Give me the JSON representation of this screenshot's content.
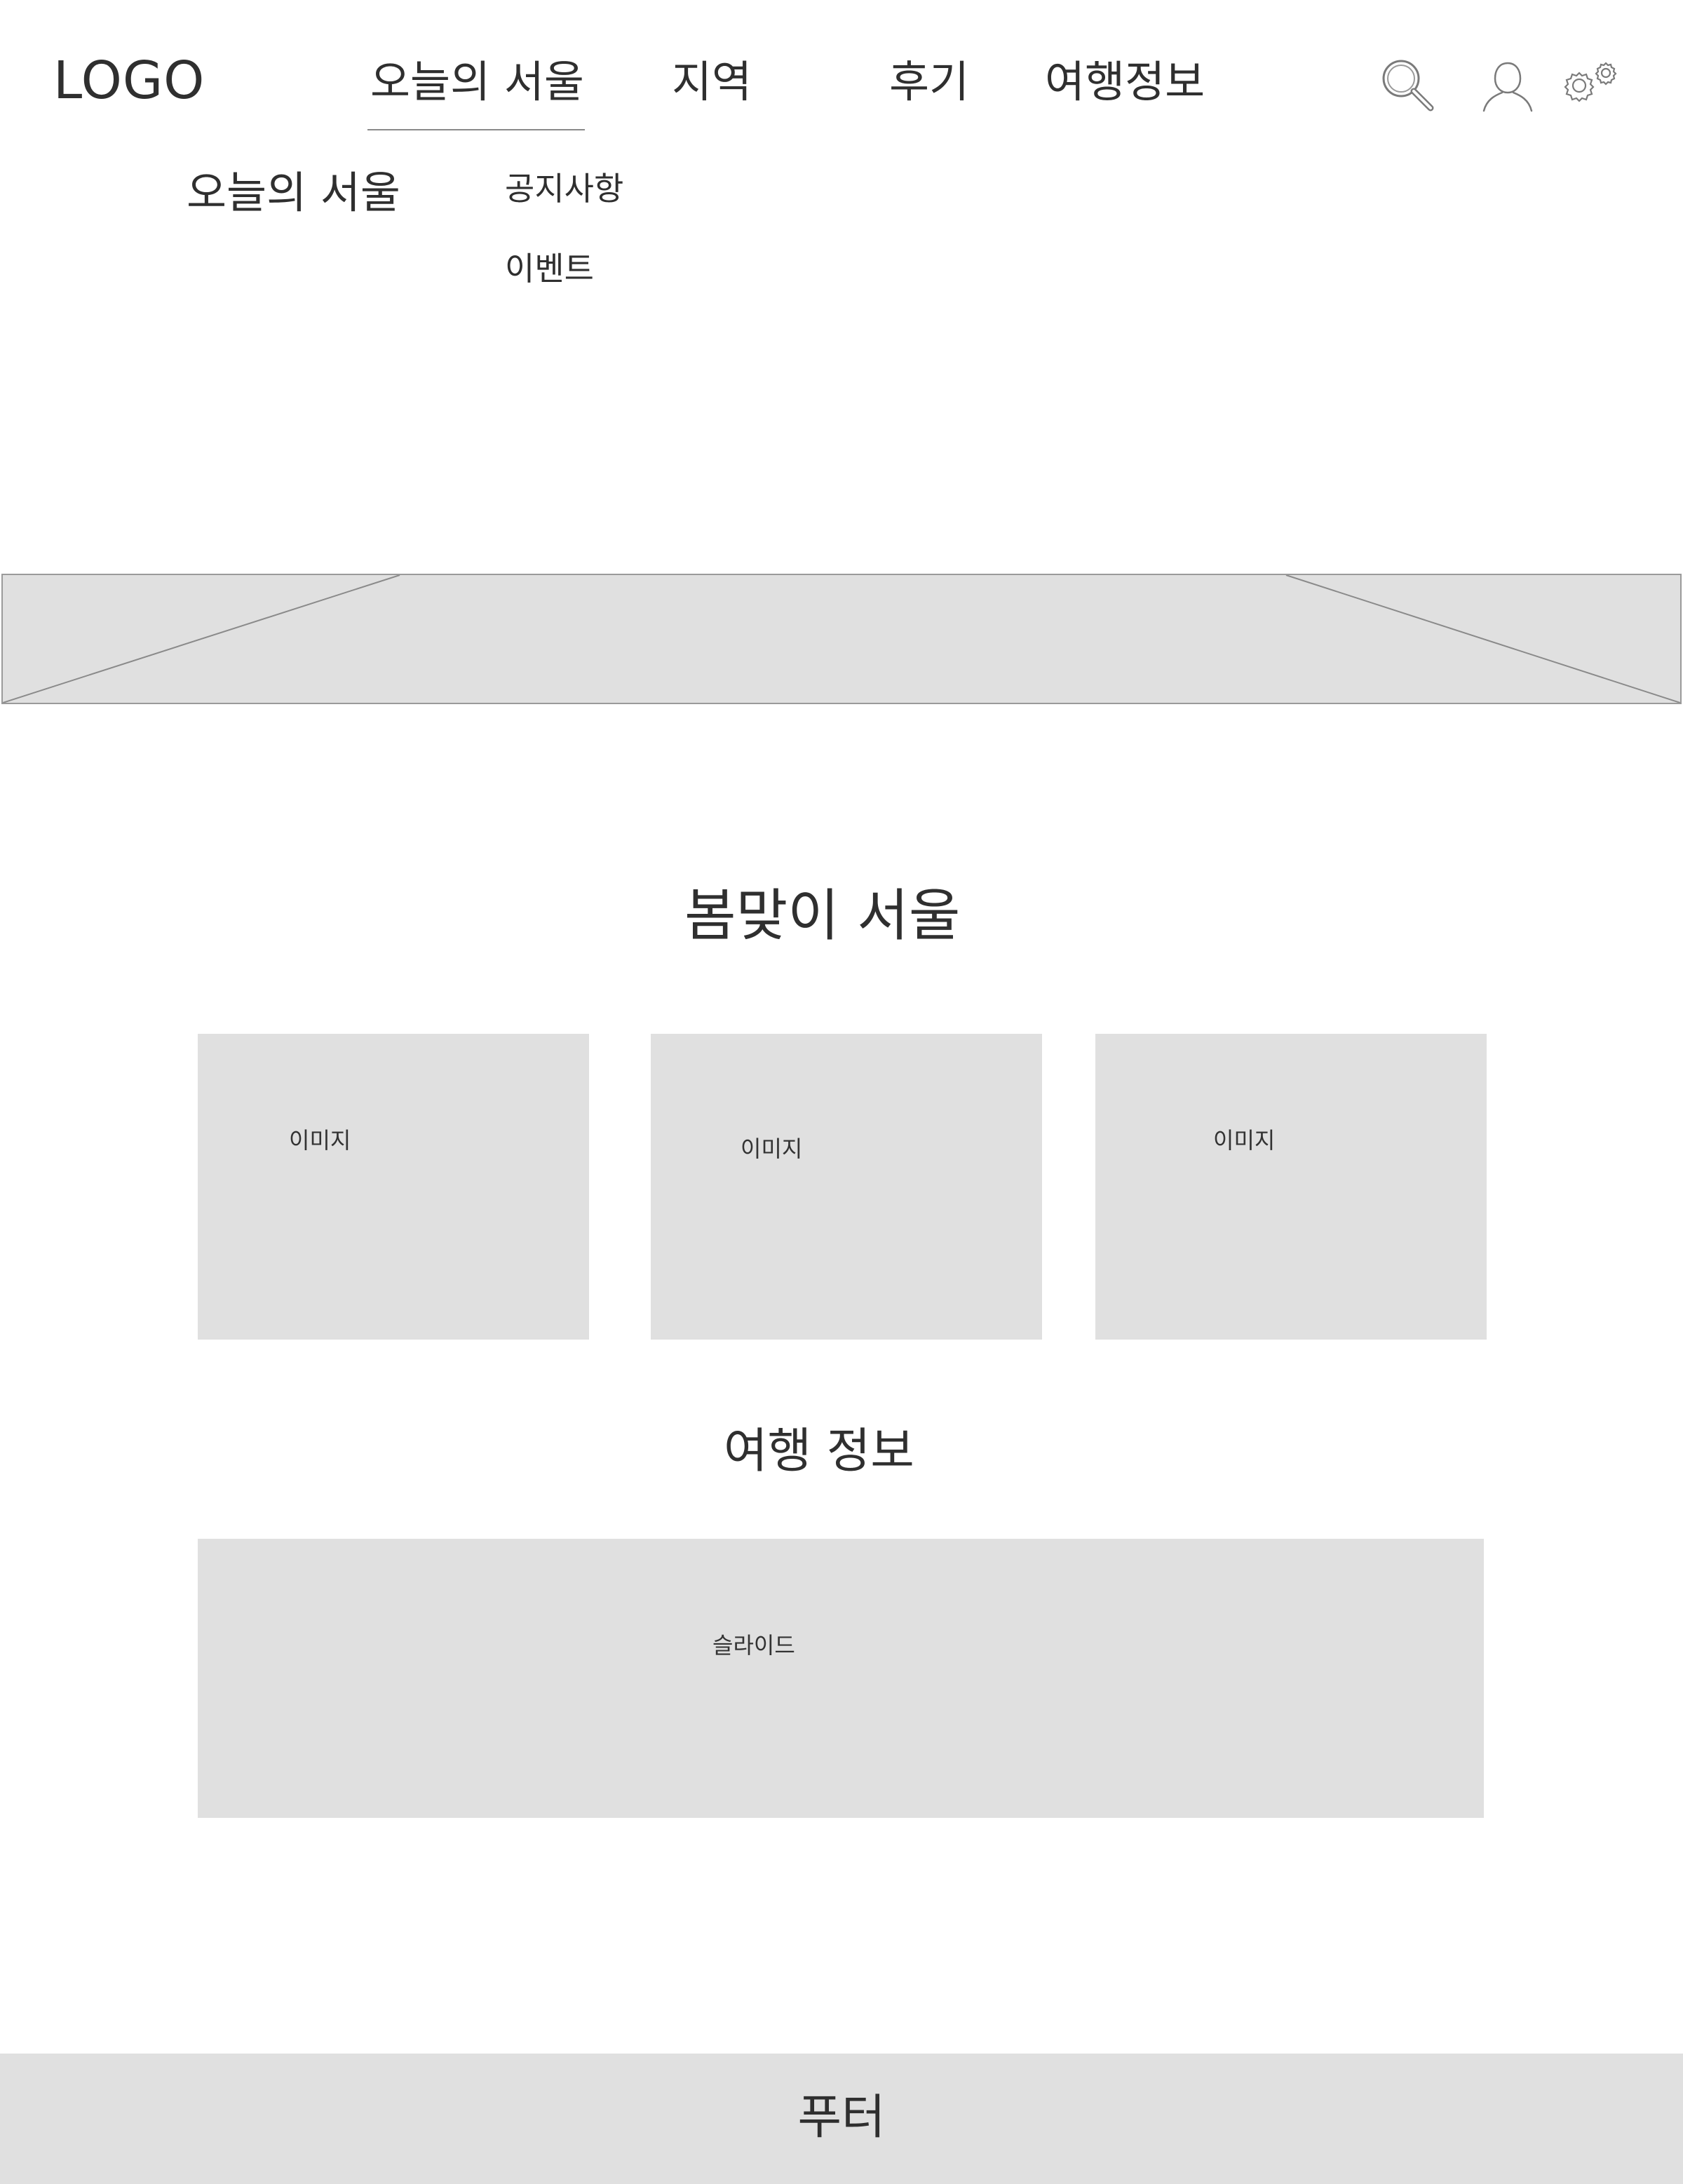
{
  "header": {
    "logo": "LOGO",
    "nav": [
      {
        "label": "오늘의 서울",
        "active": true
      },
      {
        "label": "지역"
      },
      {
        "label": "후기"
      },
      {
        "label": "여행정보"
      }
    ],
    "icons": [
      "search-icon",
      "user-icon",
      "settings-icon"
    ]
  },
  "submenu": {
    "title": "오늘의 서울",
    "links": [
      "공지사항",
      "이벤트"
    ]
  },
  "sections": {
    "spring_title": "봄맞이 서울",
    "cards": [
      "이미지",
      "이미지",
      "이미지"
    ],
    "travel_title": "여행 정보",
    "slider_label": "슬라이드"
  },
  "footer": {
    "label": "푸터"
  },
  "colors": {
    "placeholder": "#e0e0e0",
    "text": "#2f2f2f",
    "line": "#8a8a8a"
  }
}
